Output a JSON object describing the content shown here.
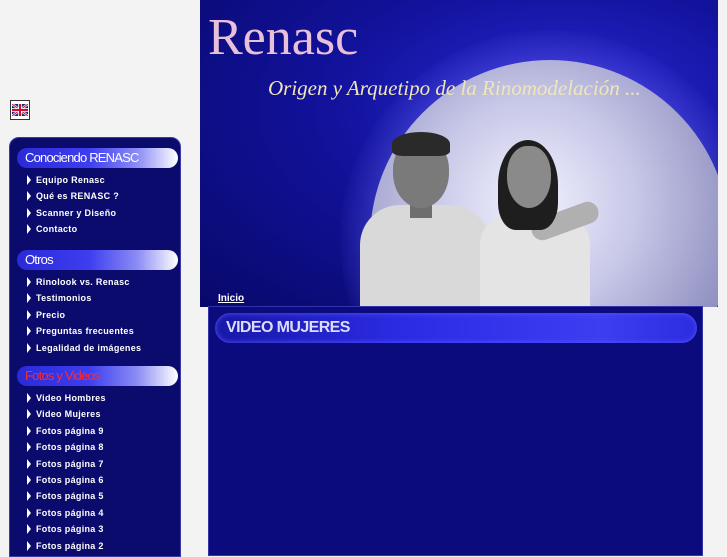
{
  "banner": {
    "title": "Renasc",
    "subtitle": "Origen y Arquetipo de la Rinomodelación ...",
    "breadcrumb": "Inicio"
  },
  "sidebar": {
    "sections": [
      {
        "title": "Conociendo RENASC",
        "items": [
          "Equipo Renasc",
          "Qué es RENASC ?",
          "Scanner y Diseño",
          "Contacto"
        ]
      },
      {
        "title": "Otros",
        "items": [
          "Rinolook vs. Renasc",
          "Testimonios",
          "Precio",
          "Preguntas frecuentes",
          "Legalidad de imágenes"
        ]
      },
      {
        "title": "Fotos y Videos",
        "items": [
          "Video Hombres",
          "Video Mujeres",
          "Fotos página 9",
          "Fotos página 8",
          "Fotos página 7",
          "Fotos página 6",
          "Fotos página 5",
          "Fotos página 4",
          "Fotos página 3",
          "Fotos página 2"
        ]
      }
    ]
  },
  "content": {
    "heading": "VIDEO MUJERES"
  },
  "colors": {
    "sidebar_bg": "#0b0b6e",
    "section_gradient_start": "#2a2ad8",
    "active_section_text": "#ff2a2a",
    "content_bg": "#0b0b7e"
  },
  "icons": {
    "language_flag": "uk-flag-icon",
    "nav_bullet": "arrow-right-icon"
  }
}
